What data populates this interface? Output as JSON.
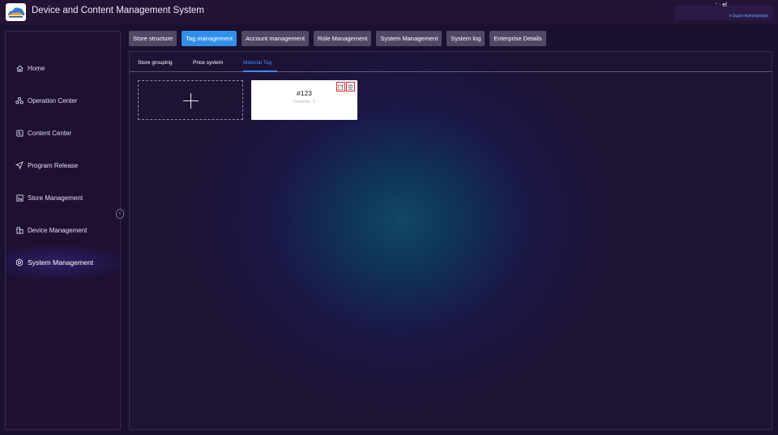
{
  "app": {
    "title": "Device and Content Management System",
    "user_name": "⁻ ᐧ el",
    "user_role": "e Super Administrator"
  },
  "sidebar": {
    "items": [
      {
        "label": "Home",
        "icon": "home-icon"
      },
      {
        "label": "Operation Center",
        "icon": "operation-icon"
      },
      {
        "label": "Content Center",
        "icon": "content-icon"
      },
      {
        "label": "Program Release",
        "icon": "send-icon"
      },
      {
        "label": "Store Management",
        "icon": "store-icon"
      },
      {
        "label": "Device Management",
        "icon": "device-icon"
      },
      {
        "label": "System Management",
        "icon": "settings-icon",
        "active": true
      }
    ],
    "collapse_glyph": "‹"
  },
  "top_tabs": [
    {
      "label": "Store structure"
    },
    {
      "label": "Tag management",
      "active": true
    },
    {
      "label": "Account management"
    },
    {
      "label": "Role Management"
    },
    {
      "label": "System Management"
    },
    {
      "label": "System log"
    },
    {
      "label": "Enterprise Details"
    }
  ],
  "sub_tabs": [
    {
      "label": "Store grouping"
    },
    {
      "label": "Price system"
    },
    {
      "label": "Material Tag",
      "active": true
    }
  ],
  "tags": [
    {
      "name": "#123",
      "contents_label": "Contents:",
      "contents_count": "1"
    }
  ],
  "colors": {
    "accent": "#2f90ec",
    "active_subtab": "#3f8df2",
    "action_border": "#e23"
  }
}
